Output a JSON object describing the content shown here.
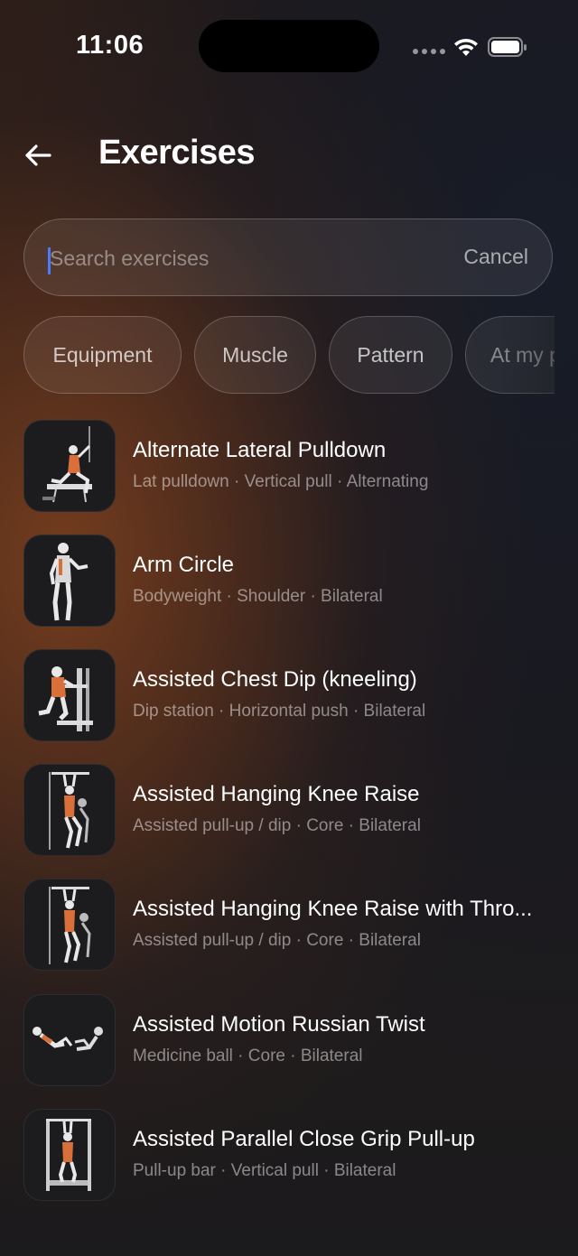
{
  "status_bar": {
    "time": "11:06"
  },
  "header": {
    "title": "Exercises",
    "back_icon": "arrow-left-icon"
  },
  "search": {
    "value": "",
    "placeholder": "Search exercises",
    "cancel_label": "Cancel"
  },
  "filters": [
    {
      "label": "Equipment"
    },
    {
      "label": "Muscle"
    },
    {
      "label": "Pattern"
    },
    {
      "label": "At my p"
    }
  ],
  "exercises": [
    {
      "title": "Alternate Lateral Pulldown",
      "subtitle": "Lat pulldown · Vertical pull · Alternating"
    },
    {
      "title": "Arm Circle",
      "subtitle": "Bodyweight · Shoulder · Bilateral"
    },
    {
      "title": "Assisted Chest Dip (kneeling)",
      "subtitle": "Dip station · Horizontal push · Bilateral"
    },
    {
      "title": "Assisted Hanging Knee Raise",
      "subtitle": "Assisted pull-up / dip · Core · Bilateral"
    },
    {
      "title": "Assisted Hanging Knee Raise with Thro...",
      "subtitle": "Assisted pull-up / dip · Core · Bilateral"
    },
    {
      "title": "Assisted Motion Russian Twist",
      "subtitle": "Medicine ball · Core · Bilateral"
    },
    {
      "title": "Assisted Parallel Close Grip Pull-up",
      "subtitle": "Pull-up bar · Vertical pull · Bilateral"
    }
  ],
  "colors": {
    "accent_caret": "#4a7cff",
    "muscle_highlight": "#d9703a"
  }
}
